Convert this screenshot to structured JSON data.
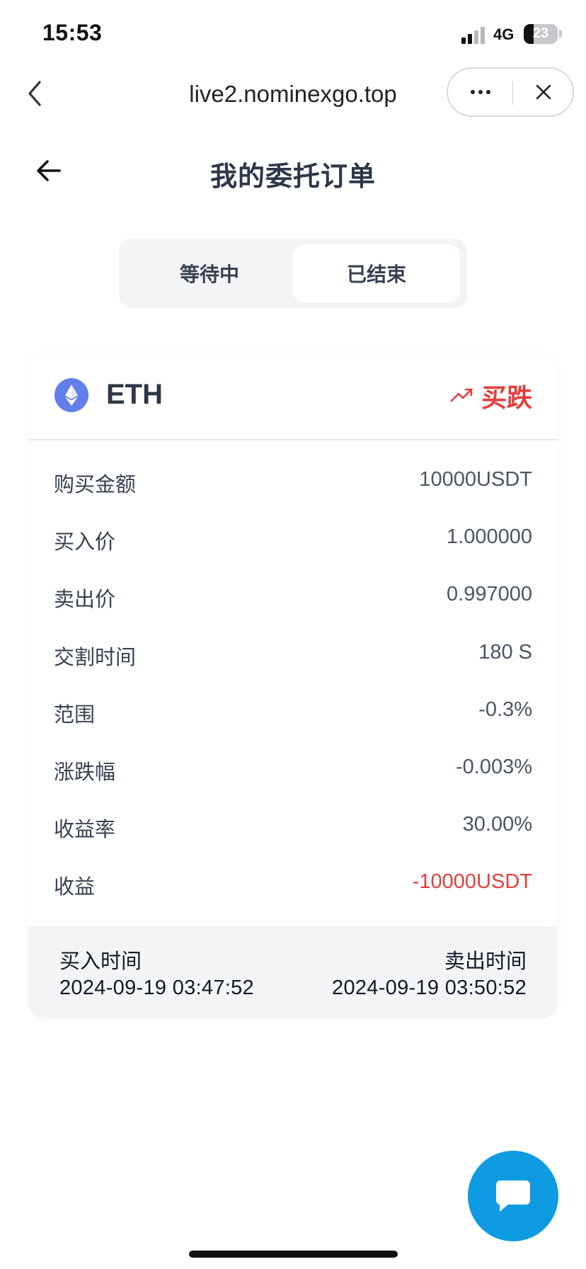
{
  "status_bar": {
    "time": "15:53",
    "network": "4G",
    "battery": "23"
  },
  "browser": {
    "url": "live2.nominexgo.top"
  },
  "page": {
    "title": "我的委托订单"
  },
  "tabs": [
    {
      "label": "等待中"
    },
    {
      "label": "已结束",
      "selected": true
    }
  ],
  "order": {
    "coin": "ETH",
    "direction": "买跌",
    "rows": [
      {
        "label": "购买金额",
        "value": "10000USDT"
      },
      {
        "label": "买入价",
        "value": "1.000000"
      },
      {
        "label": "卖出价",
        "value": "0.997000"
      },
      {
        "label": "交割时间",
        "value": "180 S"
      },
      {
        "label": "范围",
        "value": "-0.3%"
      },
      {
        "label": "涨跌幅",
        "value": "-0.003%"
      },
      {
        "label": "收益率",
        "value": "30.00%"
      },
      {
        "label": "收益",
        "value": "-10000USDT"
      }
    ],
    "buy_time_label": "买入时间",
    "buy_time": "2024-09-19 03:47:52",
    "sell_time_label": "卖出时间",
    "sell_time": "2024-09-19 03:50:52"
  },
  "colors": {
    "accent_red": "#e53e3e",
    "fab_blue": "#0e9be2",
    "eth_purple": "#627eea"
  },
  "icons": [
    "signal-icon",
    "battery-icon",
    "browser-back-icon",
    "more-icon",
    "close-icon",
    "back-arrow-icon",
    "eth-icon",
    "trend-down-icon",
    "chat-icon"
  ]
}
